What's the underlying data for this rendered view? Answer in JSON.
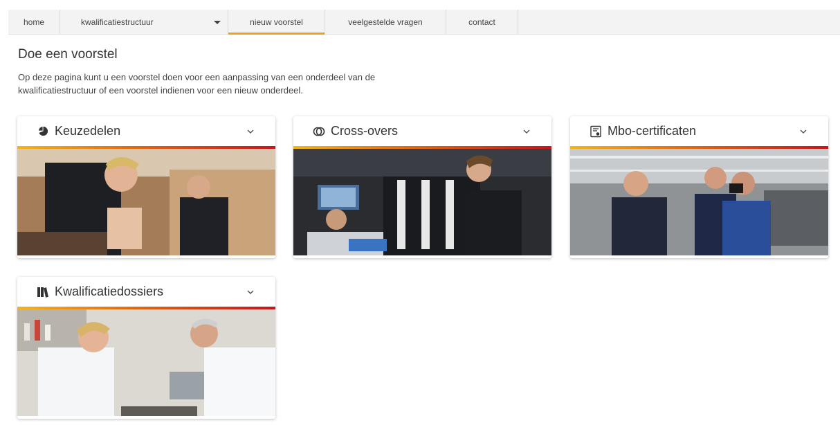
{
  "nav": {
    "items": [
      {
        "label": "home"
      },
      {
        "label": "kwalificatiestructuur"
      },
      {
        "label": "nieuw voorstel"
      },
      {
        "label": "veelgestelde vragen"
      },
      {
        "label": "contact"
      }
    ]
  },
  "page": {
    "title": "Doe een voorstel",
    "intro": "Op deze pagina kunt u een voorstel doen voor een aanpassing van een onderdeel van de kwalificatiestructuur of een voorstel indienen voor een nieuw onderdeel."
  },
  "cards": [
    {
      "title": "Keuzedelen",
      "icon": "pie-chart-icon"
    },
    {
      "title": "Cross-overs",
      "icon": "cross-over-icon"
    },
    {
      "title": "Mbo-certificaten",
      "icon": "certificate-icon"
    },
    {
      "title": "Kwalificatiedossiers",
      "icon": "binders-icon"
    }
  ],
  "colors": {
    "accent": "#f0a01e",
    "gradient_start": "#f2b41b",
    "gradient_end": "#c4151c"
  }
}
